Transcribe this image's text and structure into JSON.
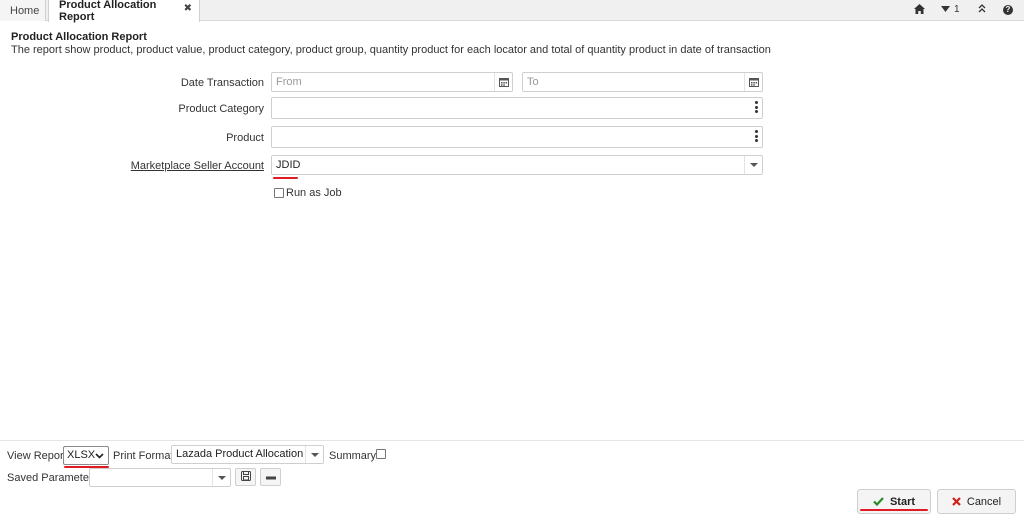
{
  "tabs": {
    "home": "Home",
    "active": "Product Allocation Report",
    "close_glyph": "✖"
  },
  "topbar": {
    "home_icon": "home-icon",
    "notification_count": "1",
    "collapse_icon": "double-chevron-up-icon",
    "help_icon": "help-icon"
  },
  "report": {
    "title": "Product Allocation Report",
    "description": "The report show product, product value, product category, product group, quantity product for each locator and total of quantity product in date of transaction"
  },
  "form": {
    "date_transaction": {
      "label": "Date Transaction",
      "from_placeholder": "From",
      "to_placeholder": "To"
    },
    "product_category": {
      "label": "Product Category",
      "value": ""
    },
    "product": {
      "label": "Product",
      "value": ""
    },
    "marketplace_seller_account": {
      "label": "Marketplace Seller Account",
      "value": "JDID"
    },
    "run_as_job": {
      "label": "Run as Job",
      "checked": false
    }
  },
  "bottom": {
    "view_report": {
      "label": "View Report",
      "value": "XLSX"
    },
    "print_format": {
      "label": "Print Format",
      "value": "Lazada Product Allocation Re"
    },
    "summary": {
      "label": "Summary",
      "checked": false
    },
    "saved_parameters": {
      "label": "Saved Parameters",
      "value": ""
    },
    "start_label": "Start",
    "cancel_label": "Cancel"
  },
  "colors": {
    "accent_red": "#e01b24",
    "start_check": "#2a8a2a",
    "cancel_x": "#d0201a"
  }
}
